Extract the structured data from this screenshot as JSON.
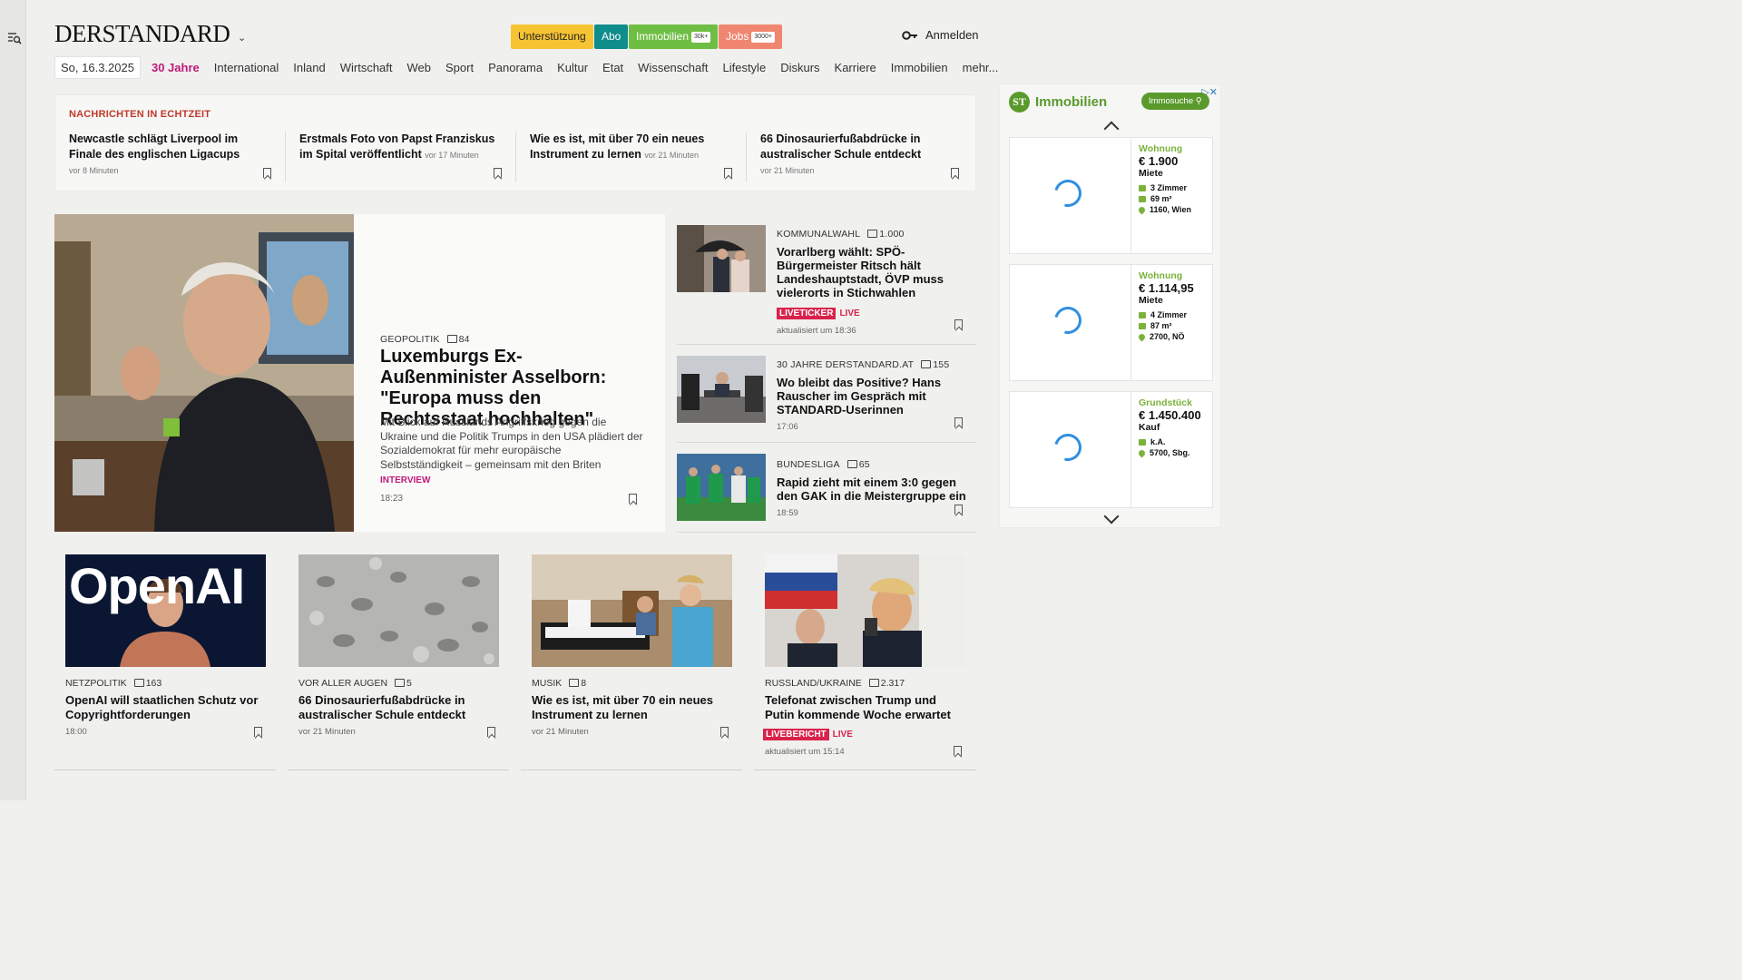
{
  "header": {
    "logo": "DERSTANDARD",
    "buttons": [
      {
        "label": "Unterstützung",
        "bg": "#f6c333",
        "fg": "#222"
      },
      {
        "label": "Abo",
        "bg": "#0f8c8c",
        "fg": "#fff"
      },
      {
        "label": "Immobilien",
        "badge": "30k+",
        "bg": "#6fbe44",
        "fg": "#fff"
      },
      {
        "label": "Jobs",
        "badge": "3000+",
        "bg": "#f08670",
        "fg": "#fff"
      }
    ],
    "login": "Anmelden"
  },
  "nav": {
    "date": "So, 16.3.2025",
    "items": [
      "30 Jahre",
      "International",
      "Inland",
      "Wirtschaft",
      "Web",
      "Sport",
      "Panorama",
      "Kultur",
      "Etat",
      "Wissenschaft",
      "Lifestyle",
      "Diskurs",
      "Karriere",
      "Immobilien",
      "mehr..."
    ]
  },
  "ticker": {
    "title": "NACHRICHTEN IN ECHTZEIT",
    "items": [
      {
        "headline": "Newcastle schlägt Liverpool im Finale des englischen Ligacups",
        "time": "vor 8 Minuten"
      },
      {
        "headline": "Erstmals Foto von Papst Franziskus im Spital veröffentlicht",
        "time": "vor 17 Minuten"
      },
      {
        "headline": "Wie es ist, mit über 70 ein neues Instrument zu lernen",
        "time": "vor 21 Minuten"
      },
      {
        "headline": "66 Dinosaurierfußabdrücke in australischer Schule entdeckt",
        "time": "vor 21 Minuten"
      }
    ]
  },
  "lead": {
    "kicker": "GEOPOLITIK",
    "comments": "84",
    "headline": "Luxemburgs Ex-Außenminister Asselborn: \"Europa muss den Rechtsstaat hochhalten\"",
    "body": "Mit Blick auf Russlands Angriffskrieg gegen die Ukraine und die Politik Trumps in den USA plädiert der Sozialdemokrat für mehr europäische Selbstständigkeit – gemeinsam mit den Briten",
    "tag": "INTERVIEW",
    "time": "18:23"
  },
  "side": [
    {
      "kicker": "KOMMUNALWAHL",
      "comments": "1.000",
      "headline": "Vorarlberg wählt: SPÖ-Bürgermeister Ritsch hält Landeshauptstadt, ÖVP muss vielerorts in Stichwahlen",
      "live_tag": "LIVETICKER",
      "live": "LIVE",
      "time": "aktualisiert um 18:36"
    },
    {
      "kicker": "30 JAHRE DERSTANDARD.AT",
      "comments": "155",
      "headline": "Wo bleibt das Positive? Hans Rauscher im Gespräch mit STANDARD-Userinnen",
      "time": "17:06"
    },
    {
      "kicker": "BUNDESLIGA",
      "comments": "65",
      "headline": "Rapid zieht mit einem 3:0 gegen den GAK in die Meistergruppe ein",
      "time": "18:59"
    }
  ],
  "cards": [
    {
      "kicker": "NETZPOLITIK",
      "comments": "163",
      "headline": "OpenAI will staatlichen Schutz vor Copyrightforderungen",
      "time": "18:00",
      "image_text": "OpenAI"
    },
    {
      "kicker": "VOR ALLER AUGEN",
      "comments": "5",
      "headline": "66 Dinosaurierfußabdrücke in australischer Schule entdeckt",
      "time": "vor 21 Minuten"
    },
    {
      "kicker": "MUSIK",
      "comments": "8",
      "headline": "Wie es ist, mit über 70 ein neues Instrument zu lernen",
      "time": "vor 21 Minuten"
    },
    {
      "kicker": "RUSSLAND/UKRAINE",
      "comments": "2.317",
      "headline": "Telefonat zwischen Trump und Putin kommende Woche erwartet",
      "live_tag": "LIVEBERICHT",
      "live": "LIVE",
      "time": "aktualisiert um 15:14"
    }
  ],
  "ad": {
    "brand": "Immobilien",
    "logo_text": "ST",
    "search": "Immosuche",
    "listings": [
      {
        "category": "Wohnung",
        "price": "€ 1.900",
        "type": "Miete",
        "rooms": "3 Zimmer",
        "area": "69 m²",
        "location": "1160, Wien"
      },
      {
        "category": "Wohnung",
        "price": "€ 1.114,95",
        "type": "Miete",
        "rooms": "4 Zimmer",
        "area": "87 m²",
        "location": "2700, NÖ"
      },
      {
        "category": "Grundstück",
        "price": "€ 1.450.400",
        "type": "Kauf",
        "area": "k.A.",
        "location": "5700, Sbg."
      }
    ]
  }
}
